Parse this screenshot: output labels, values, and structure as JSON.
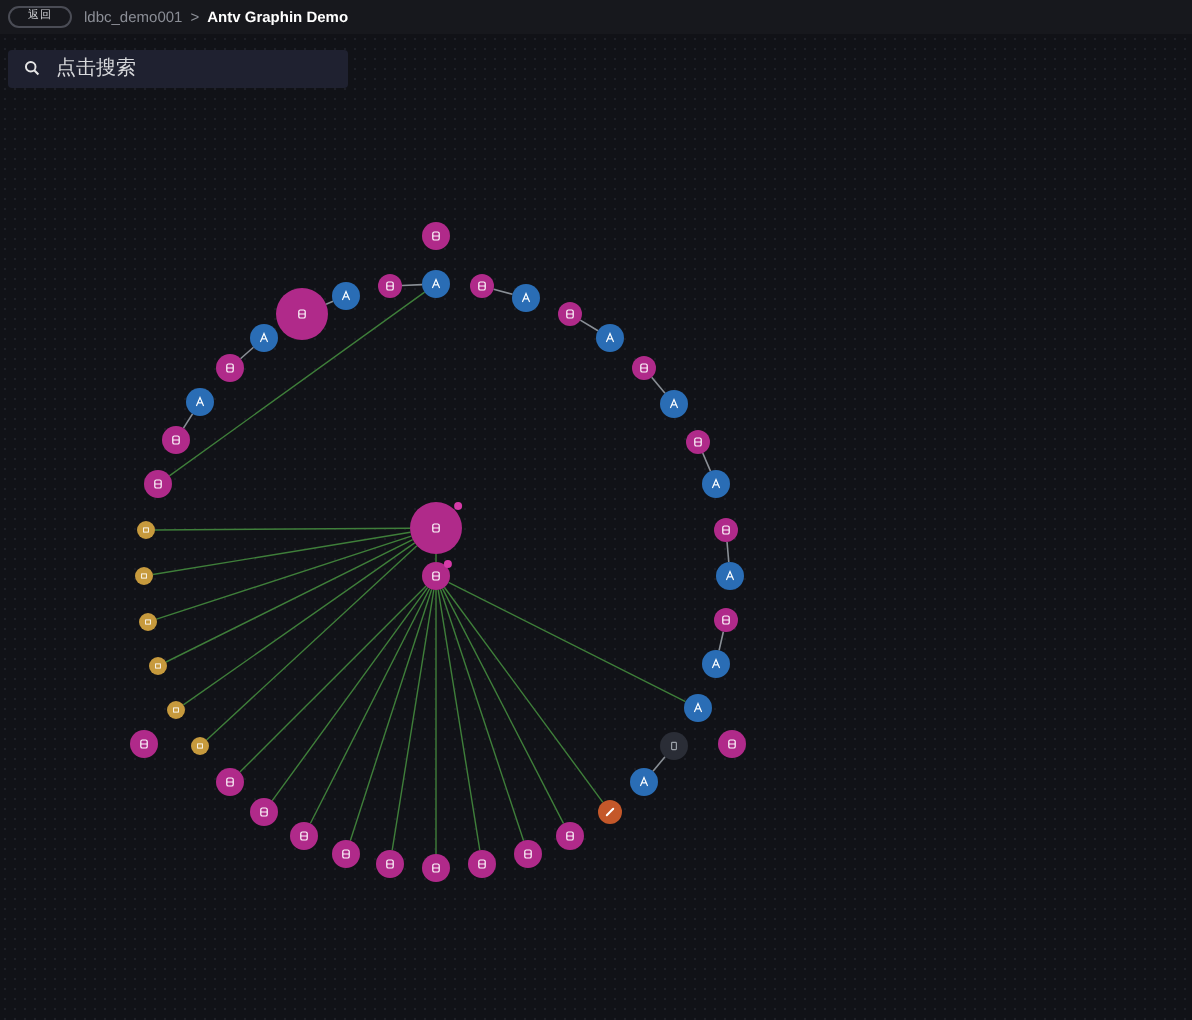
{
  "header": {
    "back_button": "返回",
    "breadcrumb": [
      {
        "label": "ldbc_demo001",
        "selected": false
      },
      {
        "label": "Antv Graphin Demo",
        "selected": true
      }
    ],
    "separator": ">"
  },
  "search": {
    "placeholder": "点击搜索"
  },
  "graph": {
    "nodes": [
      {
        "kind": "person",
        "badge": false
      },
      {
        "kind": "organization",
        "badge": false
      },
      {
        "kind": "person",
        "badge": false
      },
      {
        "kind": "person",
        "badge": false
      },
      {
        "kind": "organization",
        "badge": false
      },
      {
        "kind": "organization",
        "badge": false
      },
      {
        "kind": "person",
        "badge": false
      },
      {
        "kind": "person",
        "badge": false
      },
      {
        "kind": "organization",
        "badge": false
      },
      {
        "kind": "organization",
        "badge": false
      },
      {
        "kind": "person",
        "badge": false
      },
      {
        "kind": "person",
        "badge": false
      },
      {
        "kind": "organization",
        "badge": false
      },
      {
        "kind": "organization",
        "badge": false
      },
      {
        "kind": "person",
        "badge": false
      },
      {
        "kind": "person",
        "badge": false
      },
      {
        "kind": "person",
        "badge": false
      },
      {
        "kind": "organization",
        "badge": false
      },
      {
        "kind": "person",
        "badge": true
      },
      {
        "kind": "tag",
        "badge": false
      },
      {
        "kind": "person",
        "badge": false
      },
      {
        "kind": "tag",
        "badge": false
      },
      {
        "kind": "person",
        "badge": true
      },
      {
        "kind": "organization",
        "badge": false
      },
      {
        "kind": "tag",
        "badge": false
      },
      {
        "kind": "person",
        "badge": false
      },
      {
        "kind": "tag",
        "badge": false
      },
      {
        "kind": "organization",
        "badge": false
      },
      {
        "kind": "tag",
        "badge": false
      },
      {
        "kind": "organization",
        "badge": false
      },
      {
        "kind": "person",
        "badge": false
      },
      {
        "kind": "device",
        "badge": false
      },
      {
        "kind": "person",
        "badge": false
      },
      {
        "kind": "tag",
        "badge": false
      },
      {
        "kind": "person",
        "badge": false
      },
      {
        "kind": "organization",
        "badge": false
      },
      {
        "kind": "person",
        "badge": false
      },
      {
        "kind": "post",
        "badge": false
      },
      {
        "kind": "person",
        "badge": false
      },
      {
        "kind": "person",
        "badge": false
      },
      {
        "kind": "person",
        "badge": false
      },
      {
        "kind": "person",
        "badge": false
      },
      {
        "kind": "person",
        "badge": false
      },
      {
        "kind": "person",
        "badge": false
      },
      {
        "kind": "person",
        "badge": false
      }
    ]
  }
}
